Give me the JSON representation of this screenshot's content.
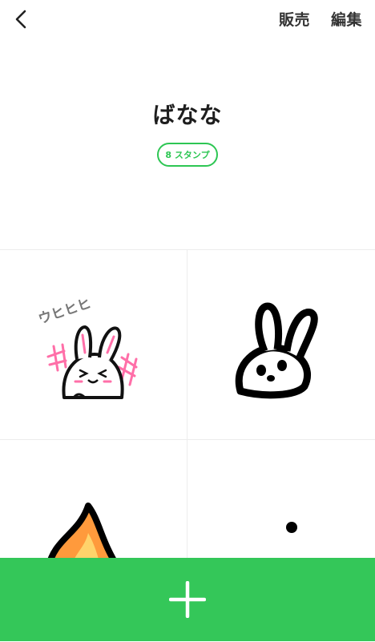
{
  "header": {
    "back_icon": "chevron-left-icon",
    "sell_label": "販売",
    "edit_label": "編集"
  },
  "pack": {
    "title": "ばなな",
    "count_label": "8 スタンプ"
  },
  "stickers": [
    {
      "caption": "ウヒヒヒ"
    },
    {
      "caption": ""
    },
    {
      "caption": ""
    },
    {
      "caption": ""
    }
  ],
  "add_button": {
    "icon": "plus-icon"
  },
  "colors": {
    "accent": "#34c759",
    "badge": "#2dc653",
    "pink": "#ff6fa8",
    "flame_orange": "#ff9a3c",
    "flame_yellow": "#ffd36b"
  }
}
